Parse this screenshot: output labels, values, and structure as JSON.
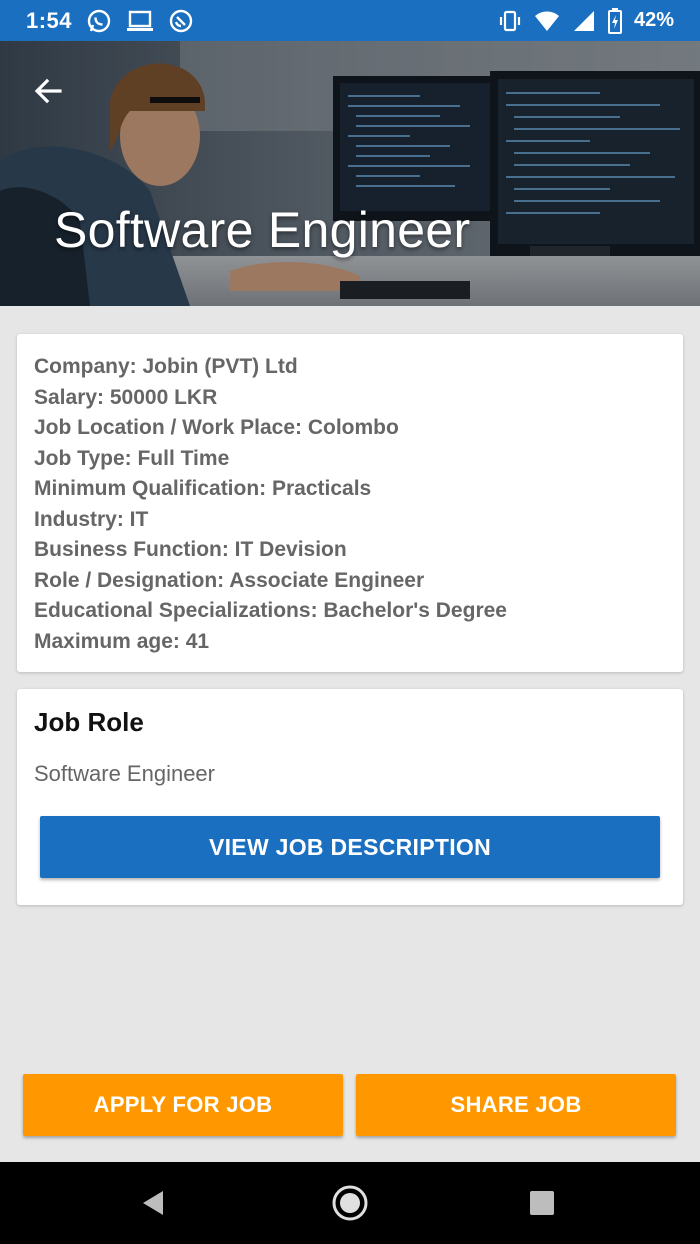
{
  "status_bar": {
    "time": "1:54",
    "battery": "42%",
    "bg_color": "#1a6fc0"
  },
  "header": {
    "title": "Software Engineer"
  },
  "details": {
    "lines": [
      "Company: Jobin (PVT) Ltd",
      "Salary: 50000 LKR",
      "Job Location / Work Place: Colombo",
      "Job Type: Full Time",
      "Minimum Qualification: Practicals",
      "Industry: IT",
      "Business Function: IT Devision",
      "Role / Designation: Associate Engineer",
      "Educational Specializations: Bachelor's Degree",
      "Maximum age: 41"
    ]
  },
  "job_role": {
    "heading": "Job Role",
    "value": "Software Engineer",
    "button_label": "VIEW JOB DESCRIPTION"
  },
  "actions": {
    "apply_label": "APPLY FOR JOB",
    "share_label": "SHARE JOB"
  },
  "colors": {
    "primary": "#1a6fc0",
    "accent": "#ff9800",
    "background": "#e6e6e6"
  },
  "icons": {
    "status_left": [
      "whatsapp-icon",
      "laptop-icon",
      "data-saver-icon"
    ],
    "status_right": [
      "vibrate-icon",
      "wifi-icon",
      "signal-icon",
      "battery-charging-icon"
    ],
    "back": "arrow-back-icon",
    "nav": [
      "nav-back-icon",
      "nav-home-icon",
      "nav-recents-icon"
    ]
  }
}
